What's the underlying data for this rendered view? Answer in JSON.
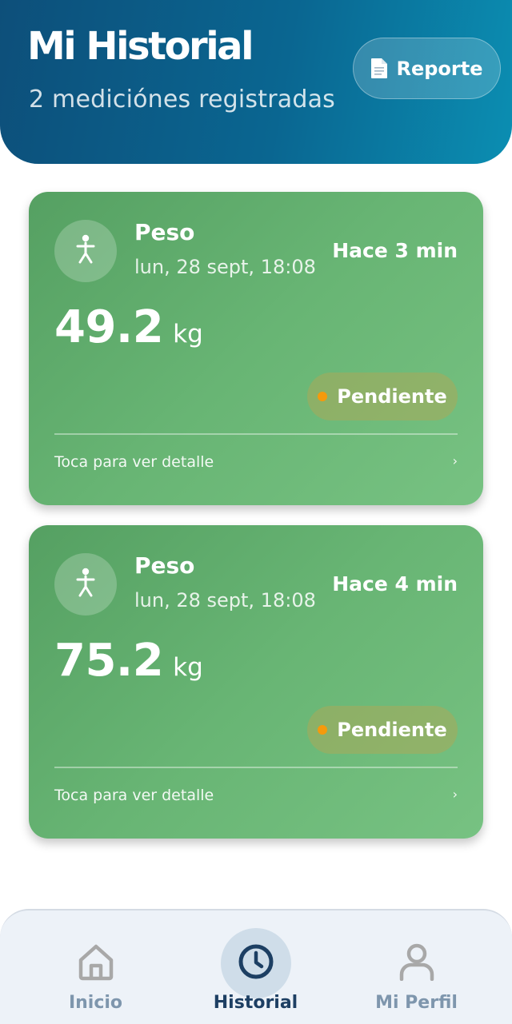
{
  "header": {
    "title": "Mi Historial",
    "subtitle": "2 mediciónes registradas",
    "report_button": "Reporte"
  },
  "cards": [
    {
      "type": "Peso",
      "date": "lun, 28 sept, 18:08",
      "ago": "Hace 3 min",
      "value": "49.2",
      "unit": "kg",
      "status": "Pendiente",
      "hint": "Toca para ver detalle",
      "chevron": "›"
    },
    {
      "type": "Peso",
      "date": "lun, 28 sept, 18:08",
      "ago": "Hace 4 min",
      "value": "75.2",
      "unit": "kg",
      "status": "Pendiente",
      "hint": "Toca para ver detalle",
      "chevron": "›"
    }
  ],
  "nav": {
    "items": [
      {
        "label": "Inicio",
        "icon": "home-icon"
      },
      {
        "label": "Historial",
        "icon": "clock-icon",
        "active": true
      },
      {
        "label": "Mi Perfil",
        "icon": "user-icon"
      }
    ]
  },
  "colors": {
    "header_gradient_start": "#0d4f7a",
    "header_gradient_end": "#0b8eb2",
    "card_green": "#66b473",
    "status_dot": "#f59a0c",
    "nav_active": "#1d3f63",
    "nav_inactive": "#7e96ad"
  }
}
